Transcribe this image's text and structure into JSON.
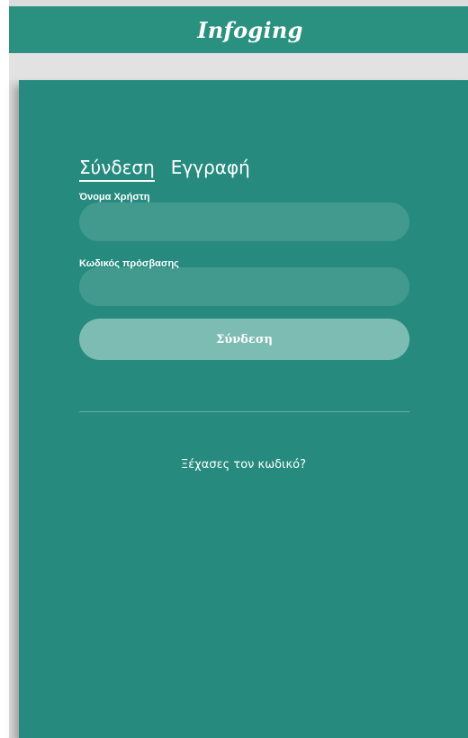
{
  "header": {
    "brand": "Infoging"
  },
  "tabs": [
    {
      "label": "Σύνδεση",
      "active": true
    },
    {
      "label": "Εγγραφή",
      "active": false
    }
  ],
  "form": {
    "username_label": "Όνομα Χρήστη",
    "username_value": "",
    "password_label": "Κωδικός πρόσβασης",
    "password_value": "",
    "submit_label": "Σύνδεση"
  },
  "footer": {
    "forgot_password": "Ξέχασες τον κωδικό?"
  },
  "colors": {
    "primary": "#268b7e",
    "header": "#2a9080",
    "button": "#7dbcb3",
    "background": "#dcdcdc"
  }
}
